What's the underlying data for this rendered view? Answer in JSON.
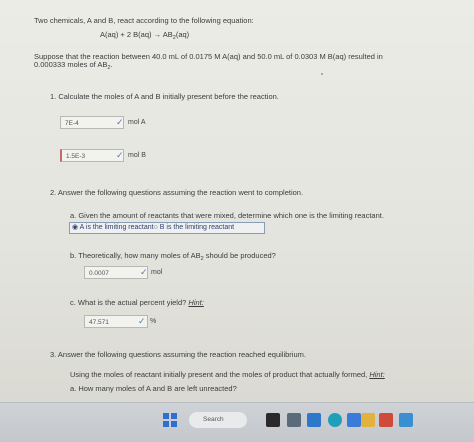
{
  "intro": "Two chemicals, A and B, react according to the following equation:",
  "equation": {
    "lhs": "A(aq) + 2 B(aq)",
    "arrow": "→",
    "product": "AB",
    "product_sub": "2",
    "product_state": "(aq)"
  },
  "paragraph": {
    "line1": "Suppose that the reaction between 40.0 mL of 0.0175 M A(aq) and 50.0 mL of 0.0303 M B(aq) resulted in",
    "line2_pre": "0.000333 moles of AB",
    "line2_sub": "2",
    "line2_post": "."
  },
  "q1": {
    "text": "1. Calculate the moles of A and B initially present before the reaction.",
    "a_value": "7E-4",
    "a_unit": "mol A",
    "b_value": "1.5E-3",
    "b_unit": "mol B"
  },
  "q2": {
    "text": "2. Answer the following questions assuming the reaction went to completion.",
    "a_text": "a. Given the amount of reactants that were mixed, determine which one is the limiting reactant.",
    "a_choice1": "A is the limiting reactant",
    "a_choice2": "B is the limiting reactant",
    "b_pre": "b. Theoretically, how many moles of AB",
    "b_sub": "2",
    "b_post": " should be produced?",
    "b_value": "0.0007",
    "b_unit": "mol",
    "c_text": "c. What is the actual percent yield?",
    "c_hint": "Hint:",
    "c_value": "47.571",
    "c_unit": "%"
  },
  "q3": {
    "text": "3. Answer the following questions assuming the reaction reached equilibrium.",
    "instr": "Using the moles of reactant initially present and the moles of product that actually formed,",
    "hint": "Hint:",
    "a_text": "a. How many moles of A and B are left unreacted?"
  },
  "taskbar": {
    "search_label": "Search"
  },
  "colors": {
    "page_bg": "#e8e8e2",
    "check": "#5a7aa8",
    "taskbar_bg": "#c9ccd0"
  }
}
